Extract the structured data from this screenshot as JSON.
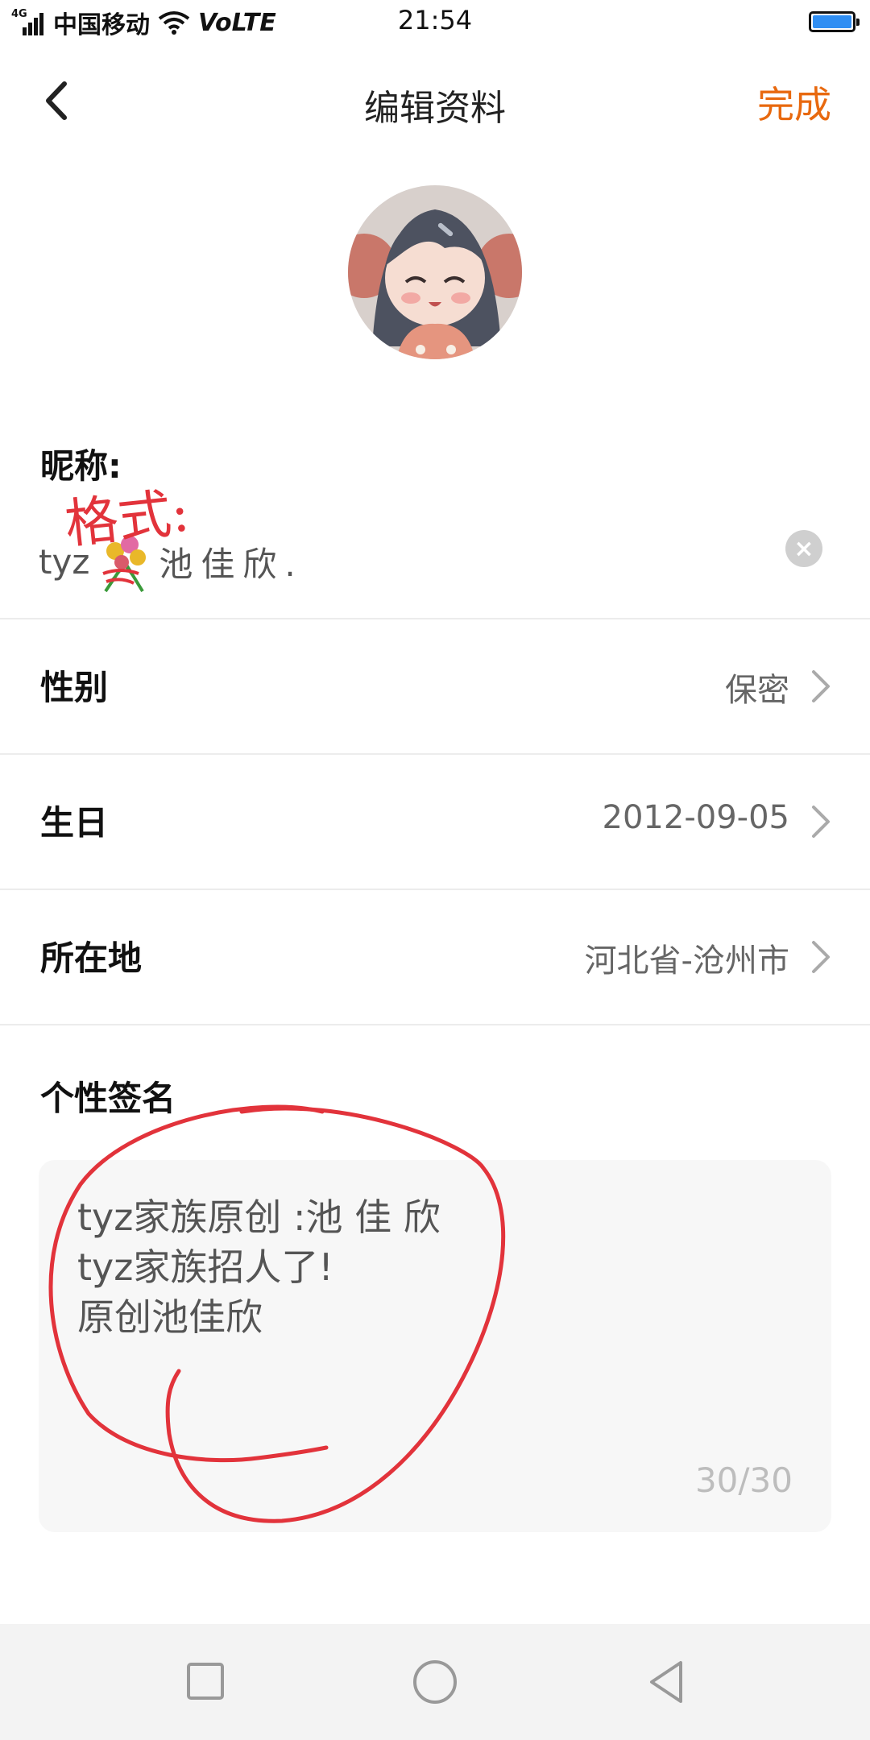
{
  "status_bar": {
    "network_type": "4G",
    "carrier": "中国移动",
    "volte": "VoLTE",
    "time": "21:54",
    "battery_color": "#2f8ef3",
    "signal_icon": "signal-icon",
    "wifi_icon": "wifi-icon",
    "battery_icon": "battery-icon"
  },
  "header": {
    "title": "编辑资料",
    "done_label": "完成",
    "done_color": "#e8690f",
    "back_icon": "chevron-left-icon"
  },
  "profile": {
    "avatar_icon": "avatar-image",
    "nickname_label": "昵称:",
    "nickname_prefix": "tyz",
    "nickname_emoji_icon": "bouquet-icon",
    "nickname_name": "池佳欣.",
    "clear_icon": "clear-icon"
  },
  "rows": [
    {
      "label": "性别",
      "value": "保密"
    },
    {
      "label": "生日",
      "value": "2012-09-05"
    },
    {
      "label": "所在地",
      "value": "河北省-沧州市"
    }
  ],
  "signature": {
    "label": "个性签名",
    "text": "tyz家族原创 :池 佳 欣\ntyz家族招人了!\n原创池佳欣",
    "counter": "30/30"
  },
  "annotations": {
    "handwritten_text": "格式:",
    "color": "#e2333b"
  },
  "nav_bar": {
    "recent_icon": "square-icon",
    "home_icon": "circle-icon",
    "back_icon": "triangle-back-icon"
  }
}
